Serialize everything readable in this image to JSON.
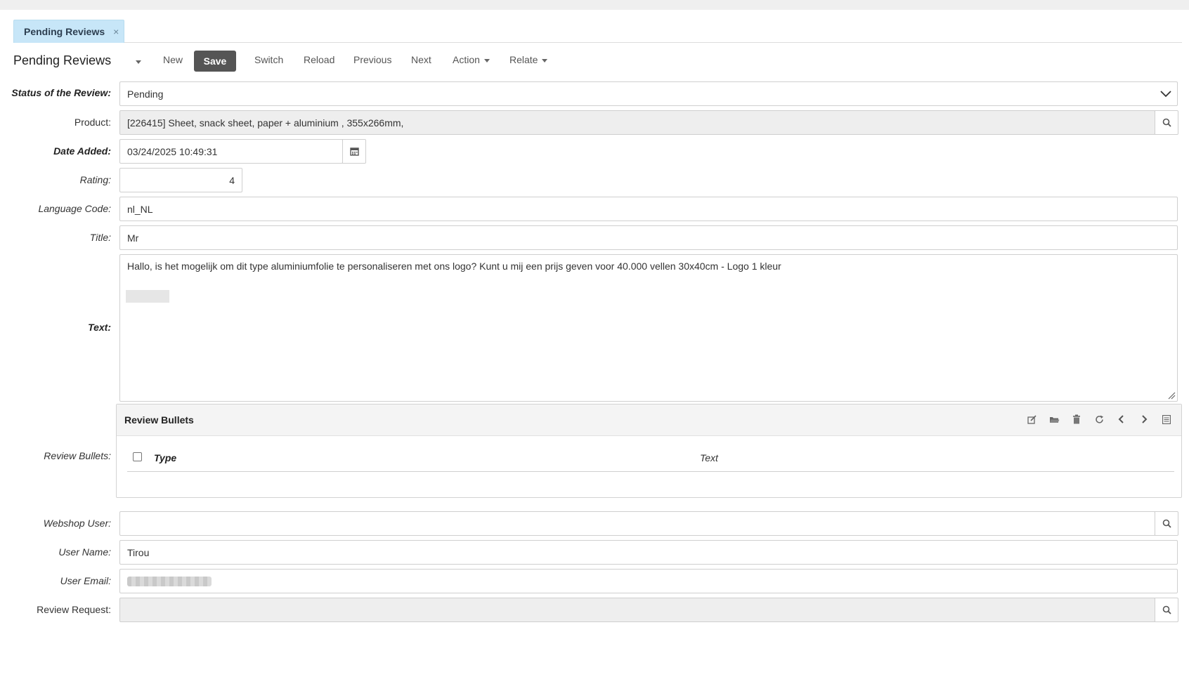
{
  "tab": {
    "label": "Pending Reviews",
    "close": "×"
  },
  "toolbar": {
    "title": "Pending Reviews",
    "new": "New",
    "save": "Save",
    "switch": "Switch",
    "reload": "Reload",
    "previous": "Previous",
    "next": "Next",
    "action": "Action",
    "relate": "Relate"
  },
  "form": {
    "status": {
      "label": "Status of the Review:",
      "value": "Pending"
    },
    "product": {
      "label": "Product:",
      "value": "[226415] Sheet, snack sheet, paper + aluminium , 355x266mm,"
    },
    "date_added": {
      "label": "Date Added:",
      "value": "03/24/2025 10:49:31"
    },
    "rating": {
      "label": "Rating:",
      "value": "4"
    },
    "language_code": {
      "label": "Language Code:",
      "value": "nl_NL"
    },
    "title": {
      "label": "Title:",
      "value": "Mr"
    },
    "text": {
      "label": "Text:",
      "value": "Hallo, is het mogelijk om dit type aluminiumfolie te personaliseren met ons logo? Kunt u mij een prijs geven voor 40.000 vellen 30x40cm - Logo 1 kleur"
    },
    "review_bullets": {
      "label": "Review Bullets:",
      "panel_title": "Review Bullets",
      "columns": [
        "Type",
        "Text"
      ]
    },
    "webshop_user": {
      "label": "Webshop User:",
      "value": ""
    },
    "user_name": {
      "label": "User Name:",
      "value": "Tirou"
    },
    "user_email": {
      "label": "User Email:"
    },
    "review_request": {
      "label": "Review Request:",
      "value": ""
    }
  },
  "icons": {
    "search": "search-icon",
    "calendar": "calendar-icon",
    "panel_tools": [
      "edit-icon",
      "folder-open-icon",
      "trash-icon",
      "refresh-icon",
      "chevron-left-icon",
      "chevron-right-icon",
      "list-icon"
    ]
  }
}
